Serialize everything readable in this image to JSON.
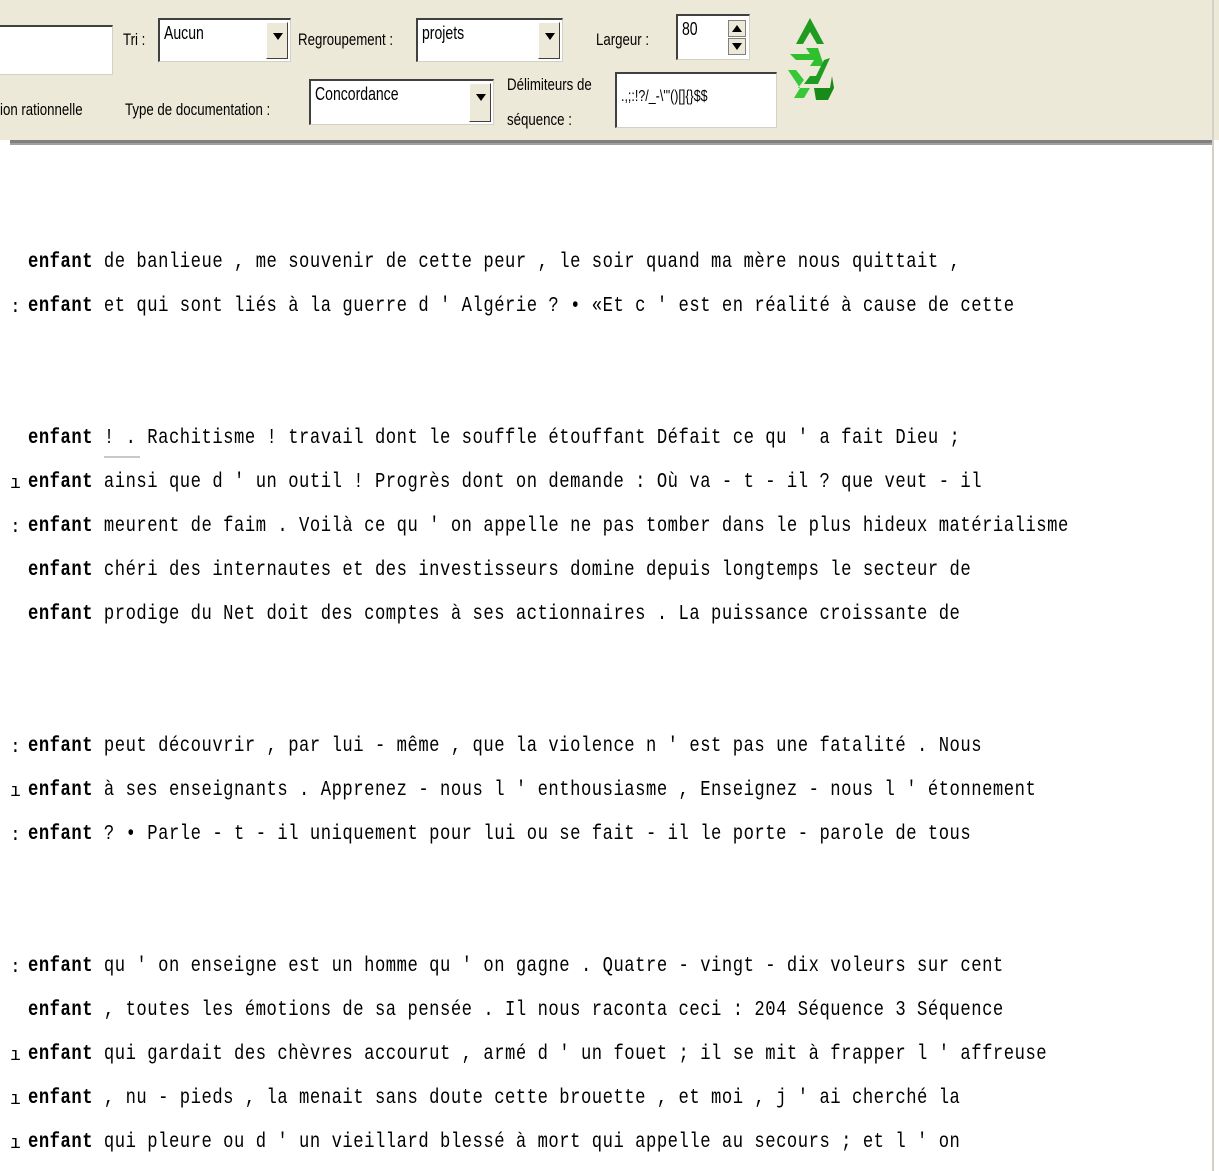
{
  "toolbar": {
    "tri_label": "Tri :",
    "tri_value": "Aucun",
    "regroupement_label": "Regroupement :",
    "regroupement_value": "projets",
    "largeur_label": "Largeur :",
    "largeur_value": "80",
    "rationnelle_label": "ion rationnelle",
    "type_doc_label": "Type de documentation :",
    "type_doc_value": "Concordance",
    "delimiteurs_label_1": "Délimiteurs de",
    "delimiteurs_label_2": "séquence :",
    "delimiteurs_value": ".,;:!?/_-\\'\"()[]{}$$",
    "refresh_icon": "recycle-icon"
  },
  "concordance": {
    "keyword": "enfant",
    "lines": [
      {
        "marker": "",
        "text": "de banlieue , me souvenir de cette peur , le soir quand ma mère nous quittait ,"
      },
      {
        "marker": ":",
        "text": "et qui sont liés à la guerre d ' Algérie ? • «Et c ' est en réalité à cause de cette"
      },
      {
        "marker": "",
        "text": "! . Rachitisme ! travail dont le souffle étouffant Défait ce qu ' a fait Dieu ;"
      },
      {
        "marker": "ı",
        "text": "ainsi que d ' un outil ! Progrès dont on demande : Où va - t - il ? que veut - il"
      },
      {
        "marker": ":",
        "text": "meurent de faim . Voilà ce qu ' on appelle ne pas tomber dans le plus hideux matérialisme"
      },
      {
        "marker": "",
        "text": "chéri des internautes et des investisseurs domine depuis longtemps le secteur de"
      },
      {
        "marker": "",
        "text": "prodige du Net doit des comptes à ses actionnaires . La puissance croissante de"
      },
      {
        "marker": ":",
        "text": "peut découvrir , par lui - même , que la violence n ' est pas une fatalité . Nous"
      },
      {
        "marker": "ı",
        "text": "à ses enseignants . Apprenez - nous l ' enthousiasme , Enseignez - nous l ' étonnement"
      },
      {
        "marker": ":",
        "text": "? • Parle - t - il uniquement pour lui ou se fait - il le porte - parole de tous"
      },
      {
        "marker": ":",
        "text": "qu ' on enseigne est un homme qu ' on gagne . Quatre - vingt - dix voleurs sur cent"
      },
      {
        "marker": "",
        "text": ", toutes les émotions de sa pensée . Il nous raconta ceci : 204 Séquence 3 Séquence"
      },
      {
        "marker": "ı",
        "text": "qui gardait des chèvres accourut , armé d ' un fouet ; il se mit à frapper l ' affreuse"
      },
      {
        "marker": "ı",
        "text": ", nu - pieds , la menait sans doute cette brouette , et moi , j ' ai cherché la"
      },
      {
        "marker": "ı",
        "text": "qui pleure ou d ' un vieillard blessé à mort qui appelle au secours ; et l ' on"
      }
    ]
  }
}
